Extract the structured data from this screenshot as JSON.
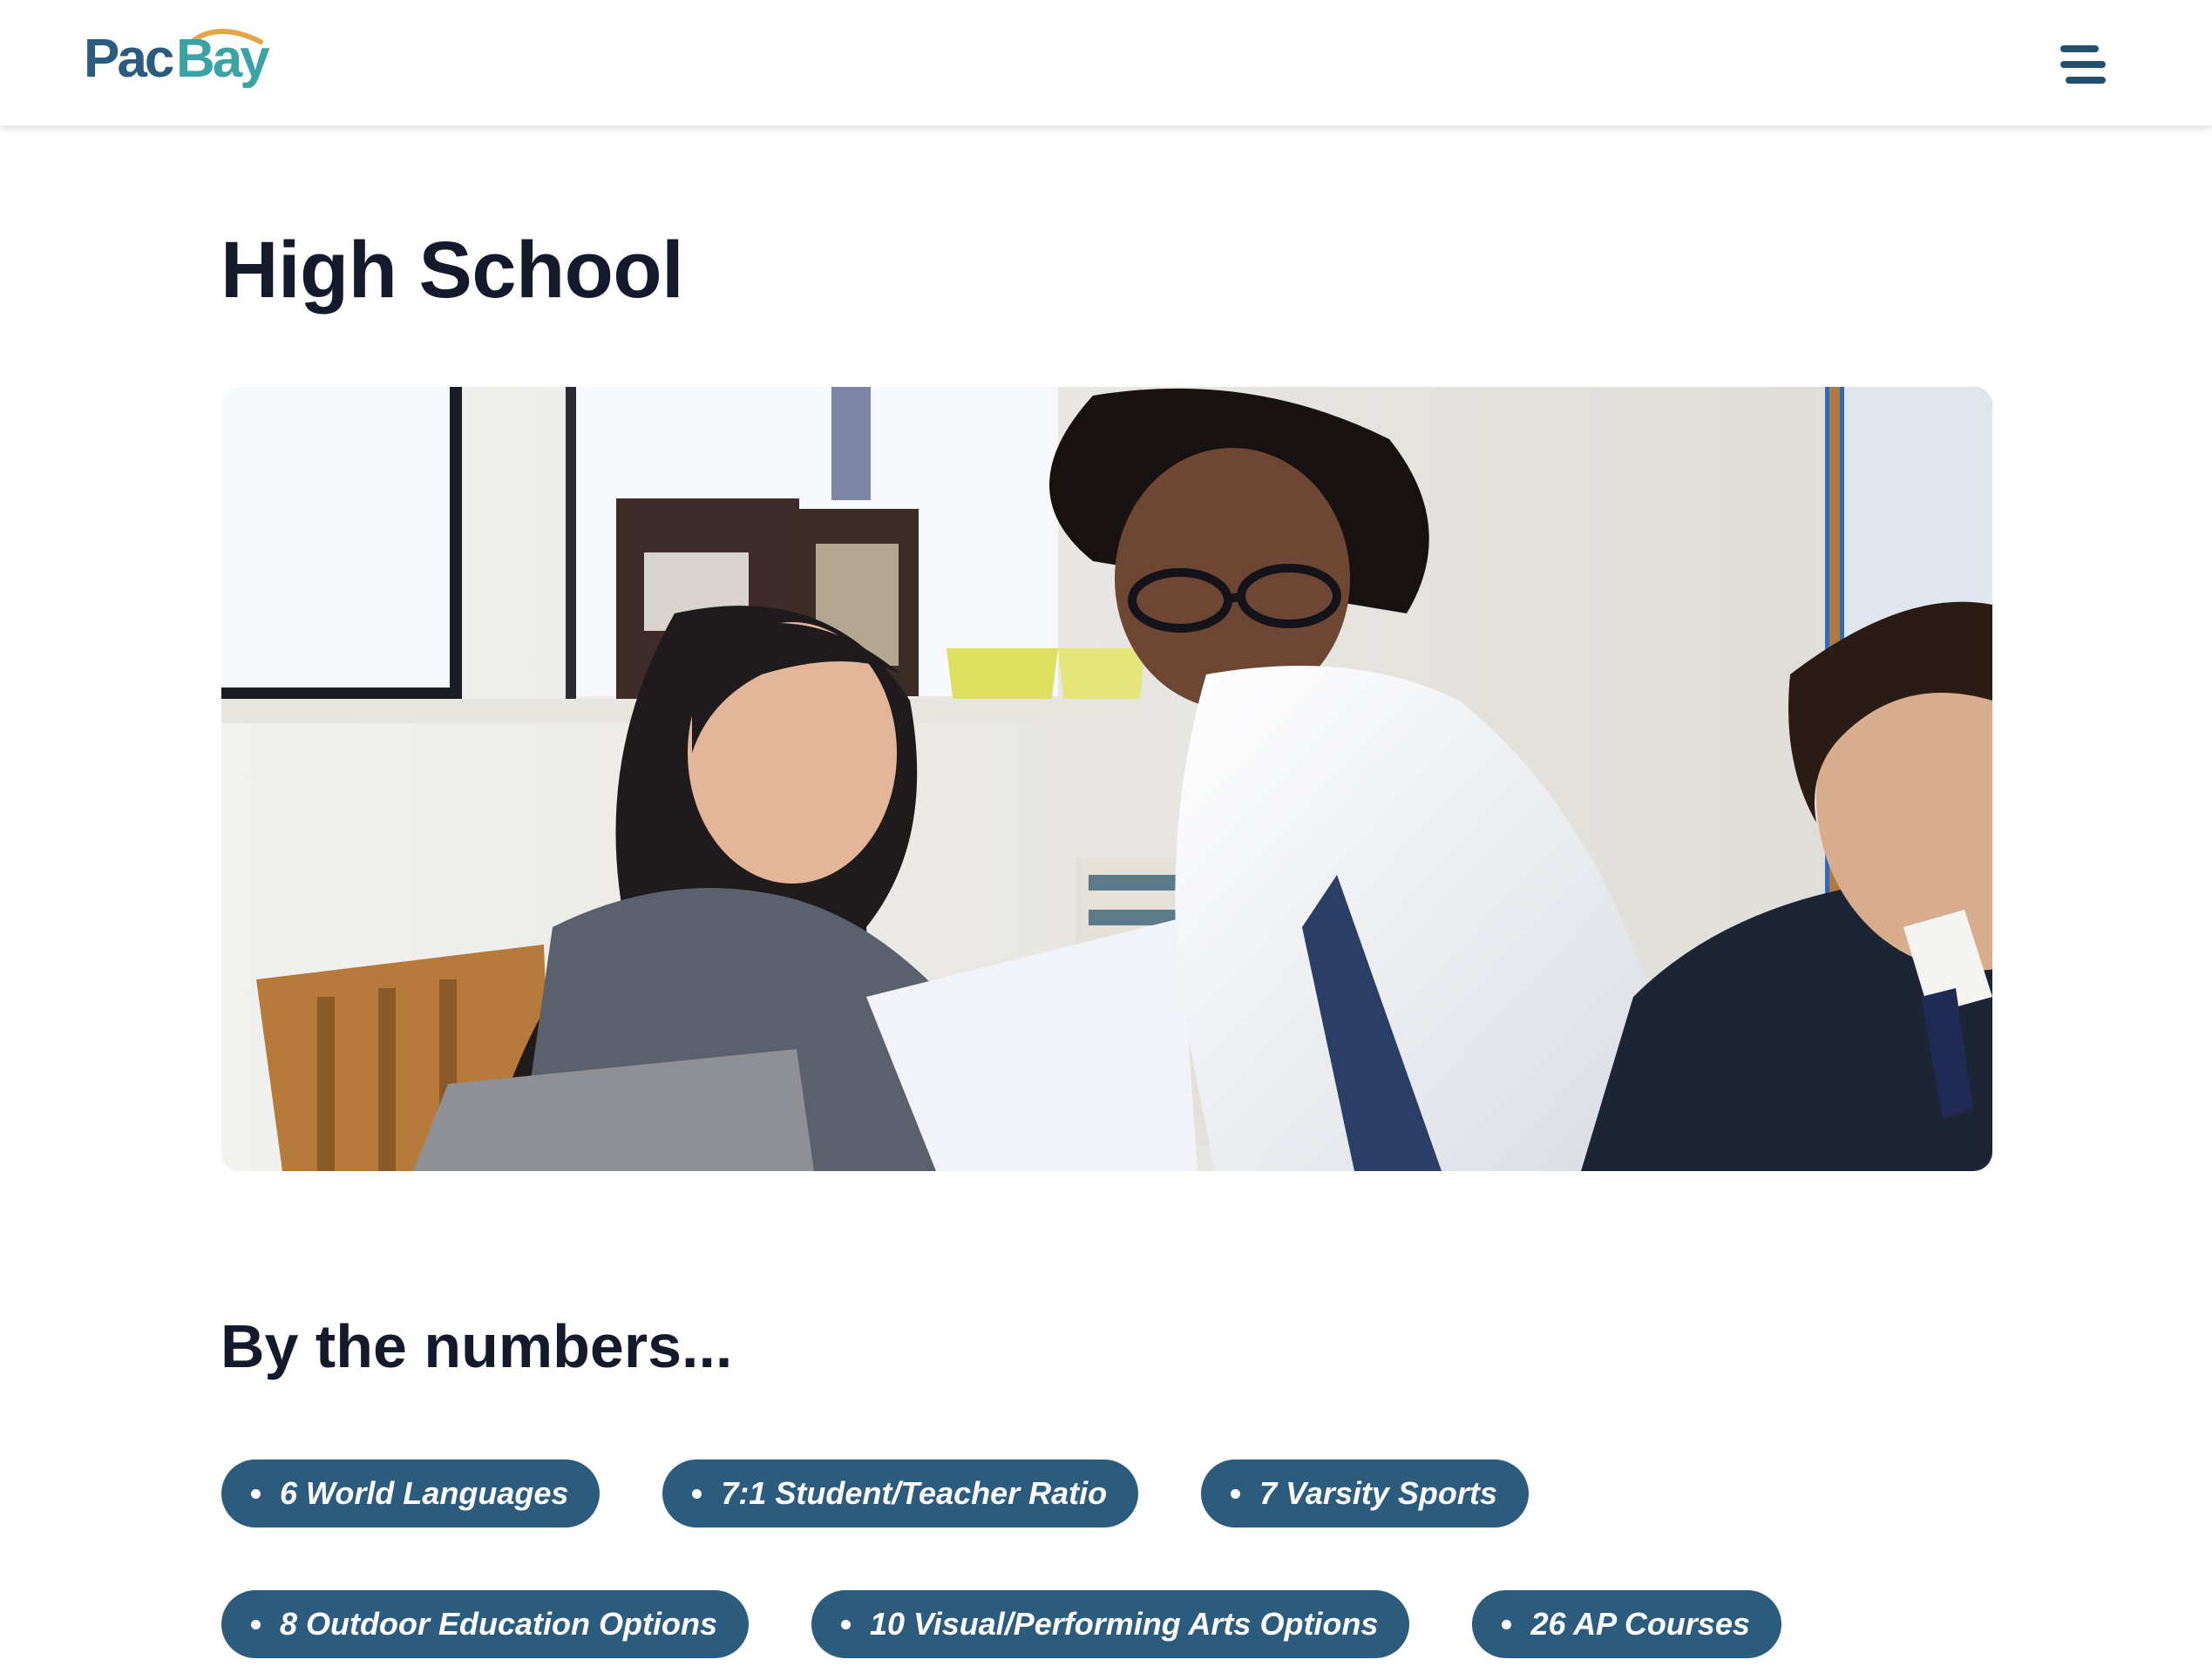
{
  "header": {
    "logo": {
      "part1": "Pac",
      "part2": "Bay"
    },
    "menu_icon": "hamburger-menu-icon"
  },
  "main": {
    "title": "High School",
    "hero_image": {
      "description": "students-working-together-photo"
    },
    "numbers_title": "By the numbers...",
    "stats": [
      {
        "label": "6 World Languages"
      },
      {
        "label": "7:1 Student/Teacher Ratio"
      },
      {
        "label": "7 Varsity Sports"
      },
      {
        "label": "8 Outdoor Education Options"
      },
      {
        "label": "10 Visual/Performing Arts Options"
      },
      {
        "label": "26 AP Courses"
      }
    ]
  },
  "colors": {
    "brand_navy": "#2b5b7d",
    "brand_teal": "#3aa3a4",
    "logo_arc": "#e3a547",
    "heading": "#141a2c",
    "pill_bg": "#2b5b7d",
    "pill_text": "#ffffff"
  }
}
